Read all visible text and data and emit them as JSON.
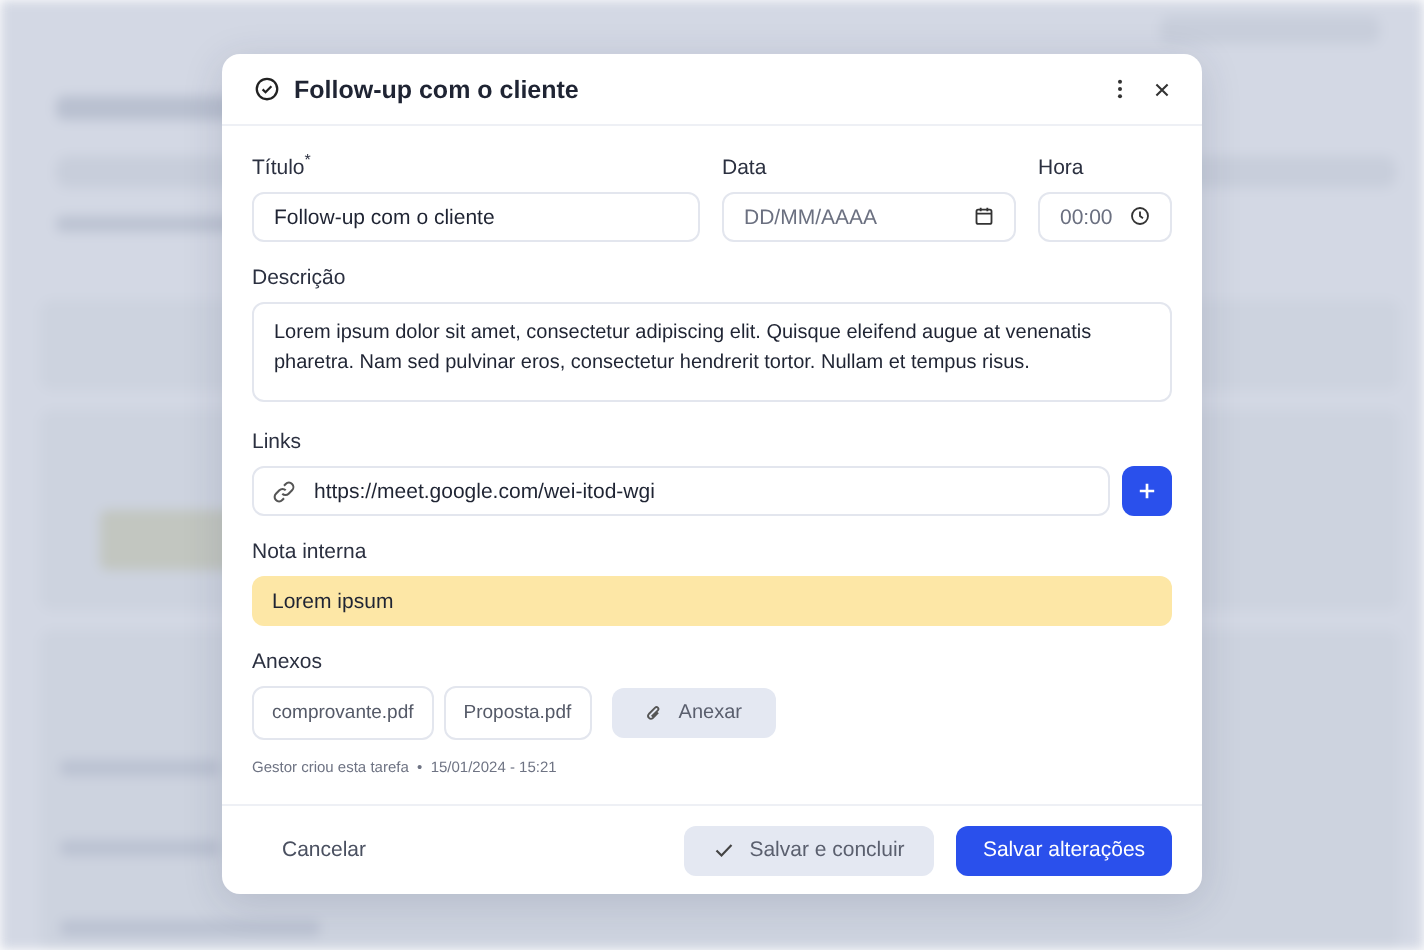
{
  "dialog": {
    "title": "Follow-up com o cliente"
  },
  "form": {
    "title_field": {
      "label": "Título$^{*}$",
      "value": "Follow-up com o cliente"
    },
    "date_field": {
      "label": "Data",
      "placeholder": "DD/MM/AAAA"
    },
    "time_field": {
      "label": "Hora",
      "placeholder": "00:00"
    },
    "description": {
      "label": "Descrição",
      "value": "Lorem ipsum dolor sit amet, consectetur adipiscing elit. Quisque eleifend augue at venenatis pharetra. Nam sed pulvinar eros, consectetur hendrerit tortor. Nullam et tempus risus."
    },
    "links": {
      "label": "Links",
      "items": [
        {
          "url": "https://meet.google.com/wei-itod-wgi"
        }
      ]
    },
    "internal_note": {
      "label": "Nota interna",
      "value": "Lorem ipsum"
    },
    "attachments": {
      "label": "Anexos",
      "files": [
        "comprovante.pdf",
        "Proposta.pdf"
      ],
      "add_button": "Anexar"
    },
    "meta": "Gestor criou esta tarefa  •  15/01/2024 - 15:21"
  },
  "footer": {
    "cancel": "Cancelar",
    "complete": "Salvar e concluir",
    "save": "Salvar alterações"
  }
}
